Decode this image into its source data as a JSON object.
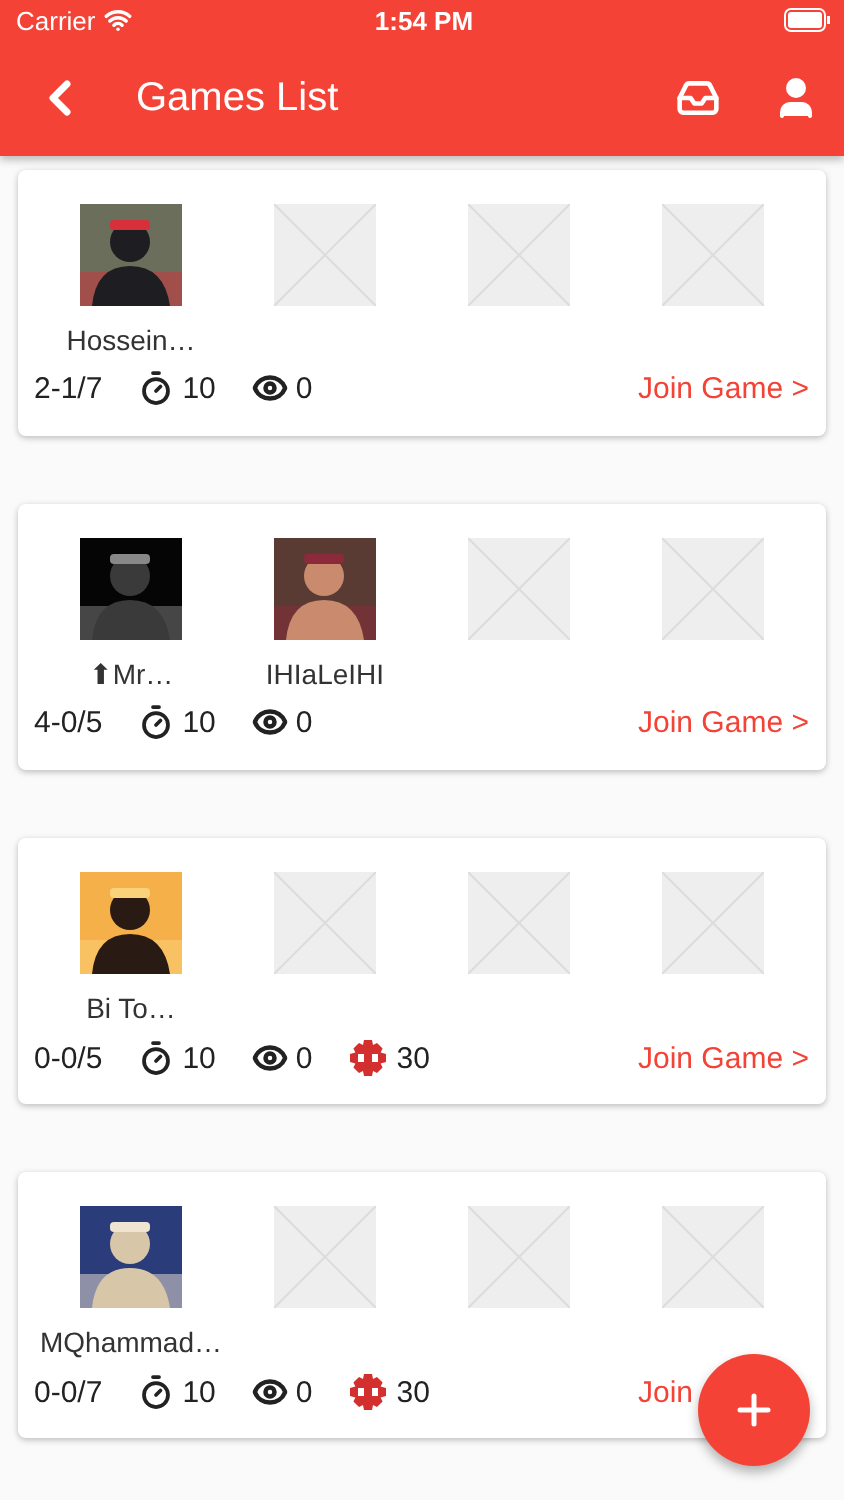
{
  "status_bar": {
    "carrier": "Carrier",
    "time": "1:54 PM"
  },
  "app_bar": {
    "title": "Games List"
  },
  "games": [
    {
      "slots": [
        {
          "kind": "player",
          "name": "Hossein…"
        },
        {
          "kind": "empty"
        },
        {
          "kind": "empty"
        },
        {
          "kind": "empty"
        }
      ],
      "score": "2-1/7",
      "timer": "10",
      "viewers": "0",
      "join": "Join Game >"
    },
    {
      "slots": [
        {
          "kind": "player",
          "name": "⬆Mr…"
        },
        {
          "kind": "player",
          "name": "IHIaLeIHI"
        },
        {
          "kind": "empty"
        },
        {
          "kind": "empty"
        }
      ],
      "score": "4-0/5",
      "timer": "10",
      "viewers": "0",
      "join": "Join Game >"
    },
    {
      "slots": [
        {
          "kind": "player",
          "name": "Bi To…"
        },
        {
          "kind": "empty"
        },
        {
          "kind": "empty"
        },
        {
          "kind": "empty"
        }
      ],
      "score": "0-0/5",
      "timer": "10",
      "viewers": "0",
      "coins": "30",
      "join": "Join Game >"
    },
    {
      "slots": [
        {
          "kind": "player",
          "name": "MQhammad…"
        },
        {
          "kind": "empty"
        },
        {
          "kind": "empty"
        },
        {
          "kind": "empty"
        }
      ],
      "score": "0-0/7",
      "timer": "10",
      "viewers": "0",
      "coins": "30",
      "join": "Join"
    }
  ]
}
